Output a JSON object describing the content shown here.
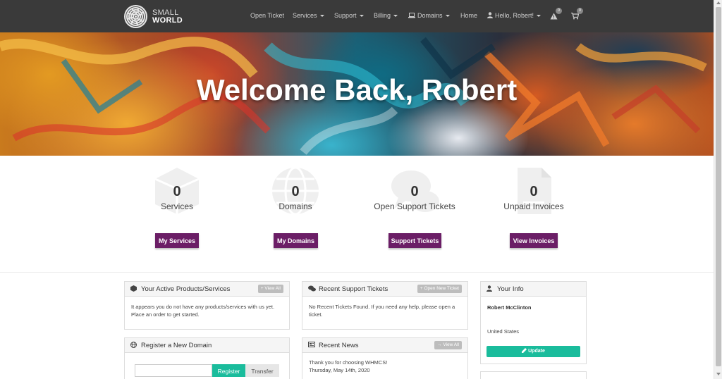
{
  "brand": {
    "line1": "SMALL",
    "line2": "WORLD"
  },
  "nav": {
    "open_ticket": "Open Ticket",
    "services": "Services",
    "support": "Support",
    "billing": "Billing",
    "domains": "Domains",
    "home": "Home",
    "user": "Hello, Robert!",
    "alerts_count": "0",
    "cart_count": "0"
  },
  "hero": {
    "title": "Welcome Back, Robert"
  },
  "stats": [
    {
      "count": "0",
      "label": "Services",
      "button": "My Services",
      "icon": "cube-icon"
    },
    {
      "count": "0",
      "label": "Domains",
      "button": "My Domains",
      "icon": "globe-icon"
    },
    {
      "count": "0",
      "label": "Open Support Tickets",
      "button": "Support Tickets",
      "icon": "comments-icon"
    },
    {
      "count": "0",
      "label": "Unpaid Invoices",
      "button": "View Invoices",
      "icon": "invoice-icon"
    }
  ],
  "panels": {
    "products": {
      "title": "Your Active Products/Services",
      "link": "+ View All",
      "body_prefix": "It appears you do not have any products/services with us yet. ",
      "body_link": "Place an order to get started",
      "body_suffix": "."
    },
    "tickets": {
      "title": "Recent Support Tickets",
      "link": "+ Open New Ticket",
      "body": "No Recent Tickets Found. If you need any help, please open a ticket."
    },
    "info": {
      "title": "Your Info",
      "name": "Robert McClinton",
      "country": "United States",
      "button": "Update"
    },
    "domain": {
      "title": "Register a New Domain",
      "register": "Register",
      "transfer": "Transfer"
    },
    "news": {
      "title": "Recent News",
      "link": "→ View All",
      "item_title": "Thank you for choosing WHMCS!",
      "item_date": "Thursday, May 14th, 2020"
    }
  },
  "colors": {
    "navbar": "#3a3a3a",
    "accent_purple": "#6b1e66",
    "accent_teal": "#1abc9c"
  }
}
